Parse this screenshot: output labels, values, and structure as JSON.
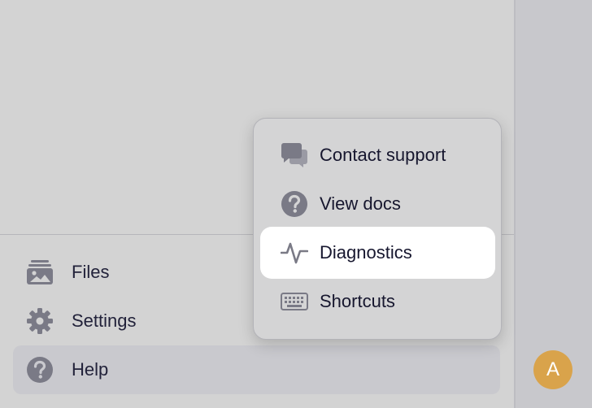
{
  "sidebar": {
    "items": [
      {
        "label": "Files",
        "icon": "files-icon"
      },
      {
        "label": "Settings",
        "icon": "gear-icon"
      },
      {
        "label": "Help",
        "icon": "help-icon"
      }
    ],
    "active": "Help"
  },
  "help_menu": {
    "items": [
      {
        "label": "Contact support",
        "icon": "chat-bubbles-icon"
      },
      {
        "label": "View docs",
        "icon": "question-circle-icon"
      },
      {
        "label": "Diagnostics",
        "icon": "activity-icon"
      },
      {
        "label": "Shortcuts",
        "icon": "keyboard-icon"
      }
    ],
    "highlighted": "Diagnostics"
  },
  "user": {
    "avatar_initial": "A"
  },
  "colors": {
    "icon": "#7a7a86",
    "avatar": "#d9a34b",
    "highlight": "#ffffff"
  }
}
